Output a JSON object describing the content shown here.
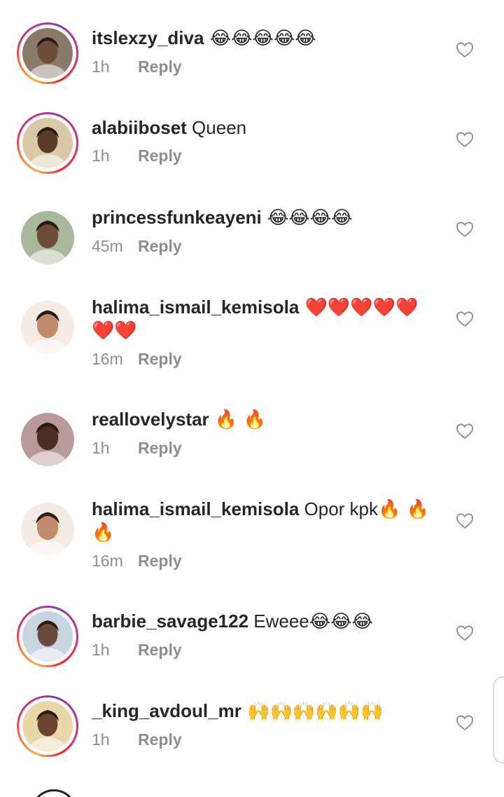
{
  "comments": [
    {
      "username": "itslexzy_diva",
      "text": "",
      "emoji": "😂😂😂😂😂",
      "emoji_after": "",
      "time": "1h",
      "reply": "Reply",
      "ring": true,
      "avatar_color": "#6b4b3a",
      "bg_color": "#8a7a6a",
      "icon": "avatar-photo"
    },
    {
      "username": "alabiiboset",
      "text": "Queen",
      "emoji": "",
      "emoji_after": "",
      "time": "1h",
      "reply": "Reply",
      "ring": true,
      "avatar_color": "#5a3a28",
      "bg_color": "#d9c9a8",
      "icon": "avatar-photo"
    },
    {
      "username": "princessfunkeayeni",
      "text": "",
      "emoji": "😂😂😂😂",
      "emoji_after": "",
      "time": "45m",
      "reply": "Reply",
      "ring": false,
      "avatar_color": "#6e4a3a",
      "bg_color": "#a8b89a",
      "icon": "avatar-photo"
    },
    {
      "username": "halima_ismail_kemisola",
      "text": "",
      "emoji": "❤️❤️❤️❤️❤️",
      "emoji_after": "❤️❤️",
      "time": "16m",
      "reply": "Reply",
      "ring": false,
      "avatar_color": "#c08a6a",
      "bg_color": "#f4ece4",
      "icon": "avatar-photo"
    },
    {
      "username": "reallovelystar",
      "text": "",
      "emoji": "🔥 🔥",
      "emoji_after": "",
      "time": "1h",
      "reply": "Reply",
      "ring": false,
      "avatar_color": "#4a2e22",
      "bg_color": "#b89a9a",
      "icon": "avatar-photo"
    },
    {
      "username": "halima_ismail_kemisola",
      "text": "Opor kpk",
      "emoji": "🔥 🔥",
      "emoji_after": "🔥",
      "time": "16m",
      "reply": "Reply",
      "ring": false,
      "avatar_color": "#c08a6a",
      "bg_color": "#f4ece4",
      "icon": "avatar-photo"
    },
    {
      "username": "barbie_savage122",
      "text": "Eweee",
      "emoji": "😂😂😂",
      "emoji_after": "",
      "time": "1h",
      "reply": "Reply",
      "ring": true,
      "avatar_color": "#6a4a3a",
      "bg_color": "#c8d4e0",
      "icon": "avatar-photo"
    },
    {
      "username": "_king_avdoul_mr",
      "text": "",
      "emoji": "🙌🙌🙌🙌🙌🙌",
      "emoji_after": "",
      "time": "1h",
      "reply": "Reply",
      "ring": true,
      "avatar_color": "#6a4430",
      "bg_color": "#e8d8a8",
      "icon": "avatar-photo"
    }
  ],
  "icons": {
    "like": "heart-outline-icon"
  },
  "colors": {
    "text": "#262626",
    "meta": "#8e8e8e",
    "ring_start": "#fcaf45",
    "ring_end": "#833ab4"
  }
}
